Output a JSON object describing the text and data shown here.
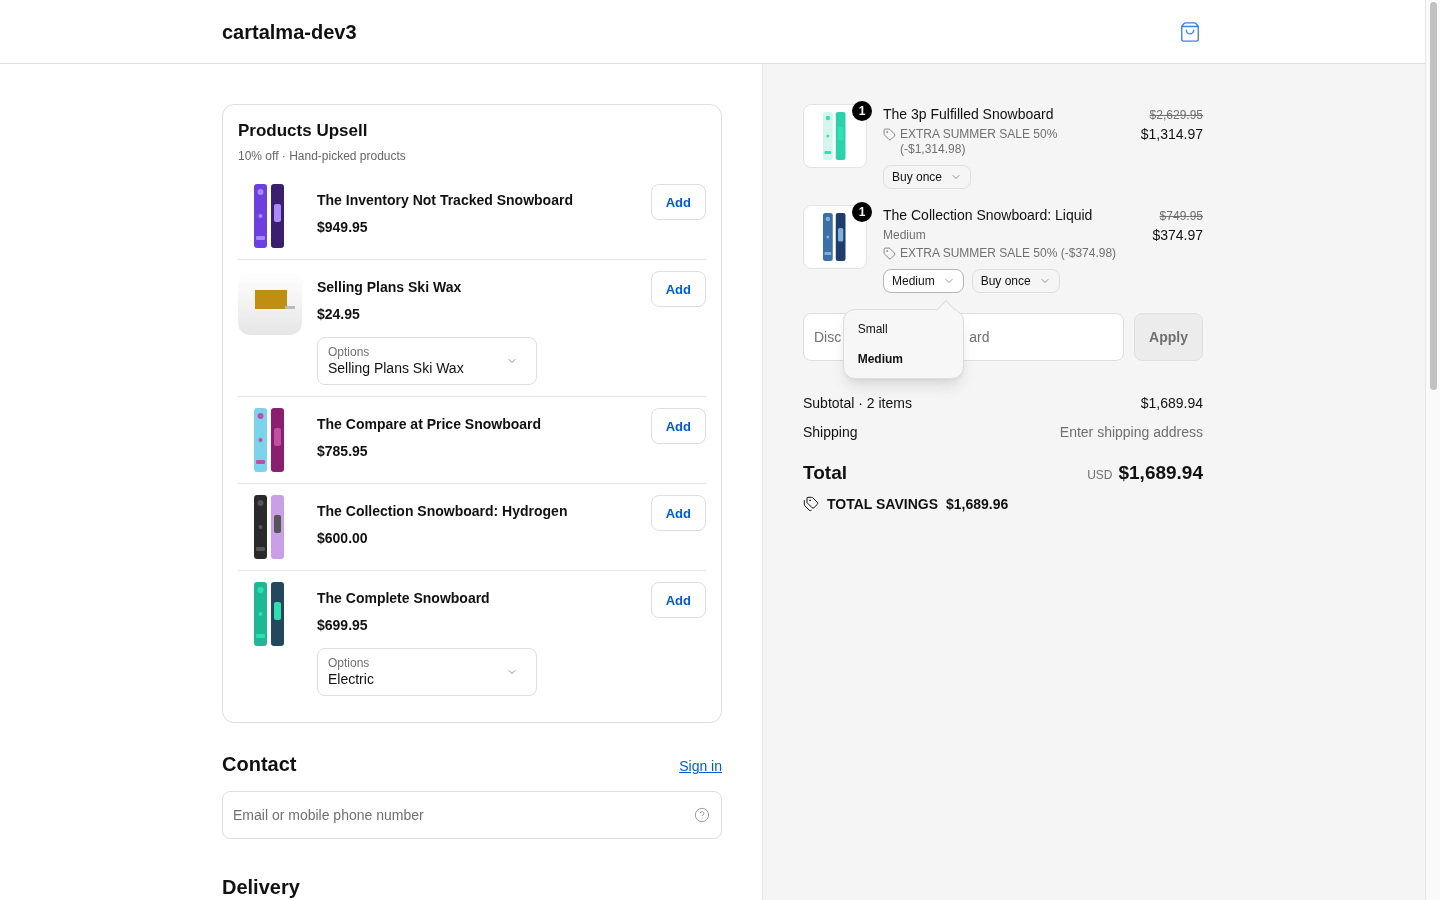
{
  "header": {
    "store_name": "cartalma-dev3"
  },
  "upsell": {
    "title": "Products Upsell",
    "subtitle": "10% off · Hand-picked products",
    "products": [
      {
        "name": "The Inventory Not Tracked Snowboard",
        "price": "$949.95",
        "button": "Add"
      },
      {
        "name": "Selling Plans Ski Wax",
        "price": "$24.95",
        "button": "Add",
        "options": {
          "label": "Options",
          "value": "Selling Plans Ski Wax"
        }
      },
      {
        "name": "The Compare at Price Snowboard",
        "price": "$785.95",
        "button": "Add"
      },
      {
        "name": "The Collection Snowboard: Hydrogen",
        "price": "$600.00",
        "button": "Add"
      },
      {
        "name": "The Complete Snowboard",
        "price": "$699.95",
        "button": "Add",
        "options": {
          "label": "Options",
          "value": "Electric"
        }
      }
    ]
  },
  "contact": {
    "title": "Contact",
    "link": "Sign in",
    "field": {
      "placeholder": "Email or mobile phone number"
    }
  },
  "delivery": {
    "title": "Delivery"
  },
  "cart": {
    "items": [
      {
        "quantity": "1",
        "name": "The 3p Fulfilled Snowboard",
        "discount": "EXTRA SUMMER SALE 50% (-$1,314.98)",
        "compare_price": "$2,629.95",
        "price": "$1,314.97",
        "selects": [
          {
            "value": "Buy once",
            "open": false
          }
        ]
      },
      {
        "quantity": "1",
        "name": "The Collection Snowboard: Liquid",
        "variant": "Medium",
        "discount": "EXTRA SUMMER SALE 50% (-$374.98)",
        "compare_price": "$749.95",
        "price": "$374.97",
        "selects": [
          {
            "value": "Medium",
            "open": true
          },
          {
            "value": "Buy once",
            "open": false
          }
        ]
      }
    ]
  },
  "variant_menu": {
    "options": [
      {
        "label": "Small",
        "selected": false
      },
      {
        "label": "Medium",
        "selected": true
      }
    ]
  },
  "discount": {
    "visible_placeholder": [
      "Disc",
      "ard"
    ],
    "button": "Apply"
  },
  "summary": {
    "rows": [
      {
        "label": "Subtotal · 2 items",
        "value": "$1,689.94",
        "kind": "amount"
      },
      {
        "label": "Shipping",
        "value": "Enter shipping address",
        "kind": "hint"
      }
    ],
    "total": {
      "label": "Total",
      "currency": "USD",
      "value": "$1,689.94"
    },
    "savings": {
      "label": "TOTAL SAVINGS",
      "value": "$1,689.96"
    }
  }
}
